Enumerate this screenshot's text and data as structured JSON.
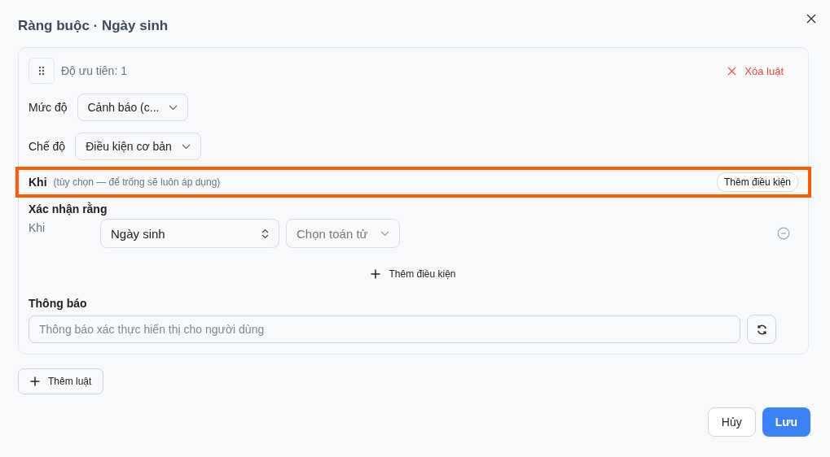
{
  "dialog": {
    "title": "Ràng buộc · Ngày sinh"
  },
  "rule": {
    "priority": "Độ ưu tiên: 1",
    "delete": "Xóa luật",
    "severity": {
      "label": "Mức độ",
      "value": "Cảnh báo (c..."
    },
    "mode": {
      "label": "Chế độ",
      "value": "Điều kiện cơ bản"
    },
    "when": {
      "label": "Khi",
      "hint": "(tùy chọn — để trống sẽ luôn áp dụng)",
      "button": "Thêm điều kiện",
      "highlighted": true
    },
    "assert": {
      "label": "Xác nhận rằng",
      "conditions": [
        {
          "prefix": "Khi",
          "field": "Ngày sinh",
          "operator_placeholder": "Chọn toán tử"
        }
      ],
      "add": "Thêm điều kiện"
    },
    "message": {
      "label": "Thông báo",
      "placeholder": "Thông báo xác thực hiển thị cho người dùng"
    }
  },
  "add_rule": "Thêm luật",
  "buttons": [
    {
      "label": "Hủy",
      "kind": "secondary"
    },
    {
      "label": "Lưu",
      "kind": "primary"
    }
  ]
}
